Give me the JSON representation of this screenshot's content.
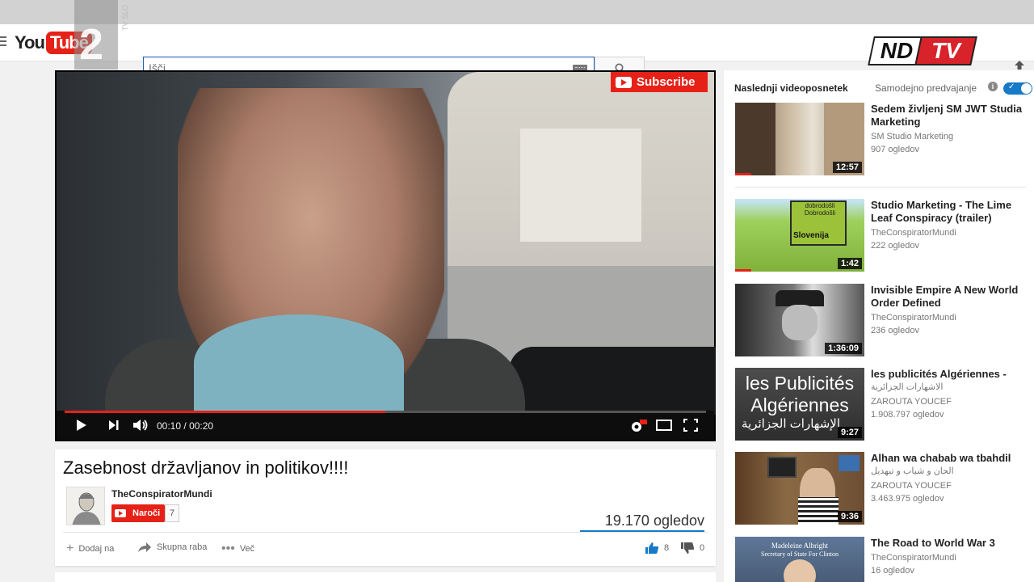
{
  "masthead": {
    "logo_you": "You",
    "logo_tube": "Tube",
    "logo_region": "SI",
    "channel_number": "2",
    "channel_side": "TV SLO",
    "search_placeholder": "Išči",
    "broadcaster_nd": "ND",
    "broadcaster_tv": "TV"
  },
  "player": {
    "overlay_subscribe": "Subscribe",
    "time_current": "00:10",
    "time_total": "00:20",
    "time_separator": "/",
    "progress_fraction": 0.5
  },
  "video": {
    "title": "Zasebnost državljanov in politikov!!!!",
    "owner": "TheConspiratorMundi",
    "subscribe_label": "Naroči",
    "subscriber_count": "7",
    "views": "19.170 ogledov",
    "actions": {
      "add_to": "Dodaj na",
      "share": "Skupna raba",
      "more": "Več"
    },
    "likes": "8",
    "dislikes": "0"
  },
  "sidebar": {
    "up_next": "Naslednji videoposnetek",
    "autoplay": "Samodejno predvajanje",
    "autoplay_on": true,
    "items": [
      {
        "title": "Sedem življenj SM JWT Studia Marketing",
        "subtitle": "",
        "channel": "SM Studio Marketing",
        "views": "907 ogledov",
        "duration": "12:57"
      },
      {
        "title": "Studio Marketing - The Lime Leaf Conspiracy (trailer)",
        "subtitle": "",
        "channel": "TheConspiratorMundi",
        "views": "222 ogledov",
        "duration": "1:42",
        "thumb_text_top": "dobrodošli Dobrodošli",
        "thumb_text": "Slovenija"
      },
      {
        "title": "Invisible Empire A New World Order Defined",
        "subtitle": "",
        "channel": "TheConspiratorMundi",
        "views": "236 ogledov",
        "duration": "1:36:09"
      },
      {
        "title": "les publicités Algériennes -",
        "subtitle": "الاشهارات الجزائرية",
        "channel": "ZAROUTA YOUCEF",
        "views": "1.908.797 ogledov",
        "duration": "9:27",
        "thumb_text": "les Publicités Algériennes",
        "thumb_text_ar": "الإشهارات الجزائرية"
      },
      {
        "title": "Alhan wa chabab wa tbahdil",
        "subtitle": "الحان و شباب و تبهديل",
        "channel": "ZAROUTA YOUCEF",
        "views": "3.463.975 ogledov",
        "duration": "9:36"
      },
      {
        "title": "The Road to World War 3",
        "subtitle": "",
        "channel": "TheConspiratorMundi",
        "views": "16 ogledov",
        "duration": "",
        "thumb_text": "Madeleine Albright",
        "thumb_text_sub": "Secretary of State For Clinton"
      }
    ]
  }
}
